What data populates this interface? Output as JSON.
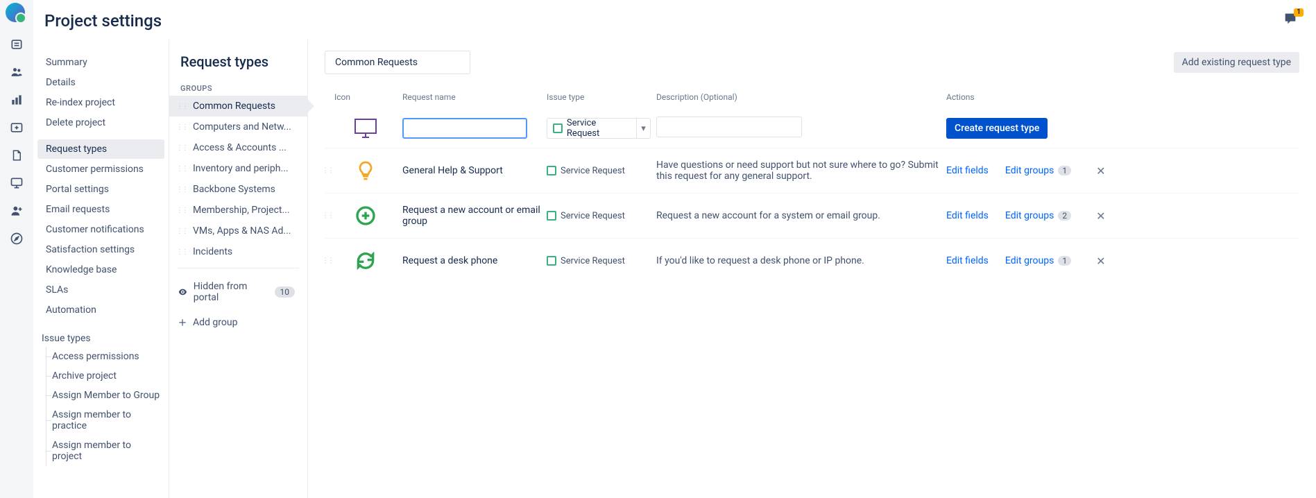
{
  "header": {
    "title": "Project settings",
    "feedback_badge": "1"
  },
  "sidebar1": {
    "items": [
      {
        "label": "Summary"
      },
      {
        "label": "Details"
      },
      {
        "label": "Re-index project"
      },
      {
        "label": "Delete project"
      },
      {
        "label": "Request types",
        "selected": true
      },
      {
        "label": "Customer permissions"
      },
      {
        "label": "Portal settings"
      },
      {
        "label": "Email requests"
      },
      {
        "label": "Customer notifications"
      },
      {
        "label": "Satisfaction settings"
      },
      {
        "label": "Knowledge base"
      },
      {
        "label": "SLAs"
      },
      {
        "label": "Automation"
      }
    ],
    "issue_types_label": "Issue types",
    "issue_types": [
      {
        "label": "Access permissions"
      },
      {
        "label": "Archive project"
      },
      {
        "label": "Assign Member to Group"
      },
      {
        "label": "Assign member to practice"
      },
      {
        "label": "Assign member to project"
      }
    ]
  },
  "sidebar2": {
    "title": "Request types",
    "groups_label": "GROUPS",
    "groups": [
      {
        "label": "Common Requests",
        "selected": true
      },
      {
        "label": "Computers and Netw..."
      },
      {
        "label": "Access & Accounts ..."
      },
      {
        "label": "Inventory and periph..."
      },
      {
        "label": "Backbone Systems"
      },
      {
        "label": "Membership, Project..."
      },
      {
        "label": "VMs, Apps & NAS Ad..."
      },
      {
        "label": "Incidents"
      }
    ],
    "hidden_label": "Hidden from portal",
    "hidden_count": "10",
    "add_group_label": "Add group"
  },
  "workarea": {
    "group_name": "Common Requests",
    "add_existing_label": "Add existing request type",
    "columns": {
      "icon": "Icon",
      "name": "Request name",
      "issue": "Issue type",
      "desc": "Description (Optional)",
      "actions": "Actions"
    },
    "form": {
      "name_value": "",
      "issue_type": "Service Request",
      "desc_value": "",
      "create_label": "Create request type"
    },
    "rows": [
      {
        "icon": "lightbulb",
        "name": "General Help & Support",
        "issue": "Service Request",
        "desc": "Have questions or need support but not sure where to go? Submit this request for any general support.",
        "edit_fields": "Edit fields",
        "edit_groups": "Edit groups",
        "groups_count": "1"
      },
      {
        "icon": "plus-circle",
        "name": "Request a new account or email group",
        "issue": "Service Request",
        "desc": "Request a new account for a system or email group.",
        "edit_fields": "Edit fields",
        "edit_groups": "Edit groups",
        "groups_count": "2"
      },
      {
        "icon": "refresh",
        "name": "Request a desk phone",
        "issue": "Service Request",
        "desc": "If you'd like to request a desk phone or IP phone.",
        "edit_fields": "Edit fields",
        "edit_groups": "Edit groups",
        "groups_count": "1"
      }
    ]
  }
}
